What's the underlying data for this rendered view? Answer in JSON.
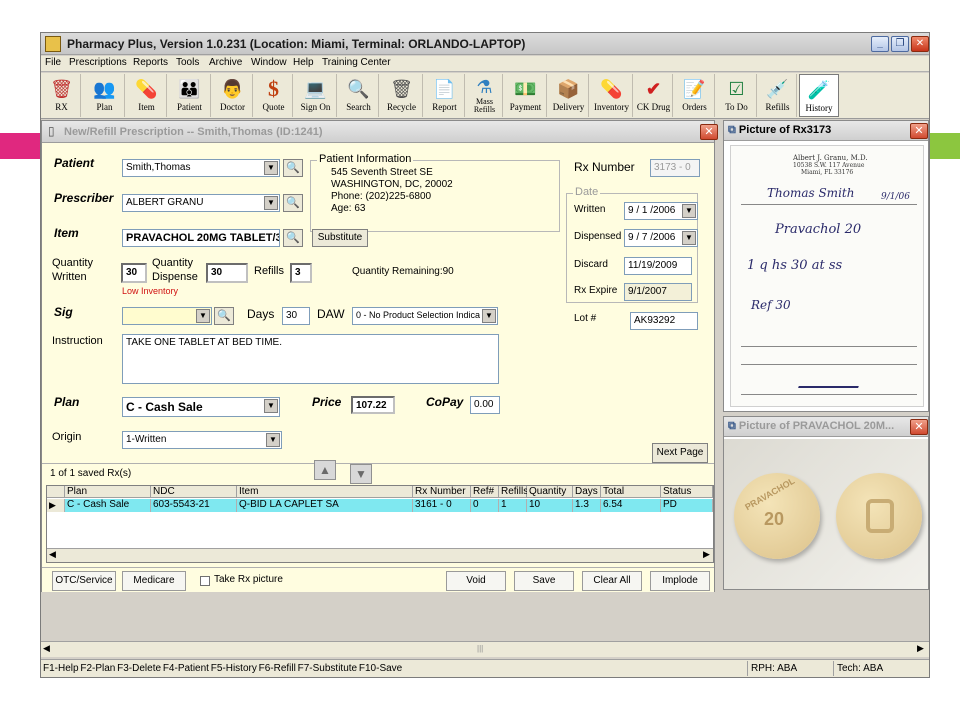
{
  "window": {
    "title": "Pharmacy Plus, Version 1.0.231 (Location: Miami, Terminal: ORLANDO-LAPTOP)",
    "minimize": "_",
    "maximize": "❐",
    "close": "✕"
  },
  "menu": [
    "File",
    "Prescriptions",
    "Reports",
    "Tools",
    "Archive",
    "Window",
    "Help",
    "Training Center"
  ],
  "toolbar": [
    {
      "label": "RX",
      "icon": "rx-icon",
      "glyph": "🗑"
    },
    {
      "label": "Plan",
      "icon": "plan-icon",
      "glyph": "👥"
    },
    {
      "label": "Item",
      "icon": "item-icon",
      "glyph": "💊"
    },
    {
      "label": "Patient",
      "icon": "patient-icon",
      "glyph": "👪"
    },
    {
      "label": "Doctor",
      "icon": "doctor-icon",
      "glyph": "👨"
    },
    {
      "label": "Quote",
      "icon": "quote-icon",
      "glyph": "$"
    },
    {
      "label": "Sign On",
      "icon": "sign-on-icon",
      "glyph": "💻"
    },
    {
      "label": "Search",
      "icon": "search-icon",
      "glyph": "🔍"
    },
    {
      "label": "Recycle",
      "icon": "recycle-icon",
      "glyph": "🗑"
    },
    {
      "label": "Report",
      "icon": "report-icon",
      "glyph": "📄"
    },
    {
      "label": "Mass Refills",
      "icon": "mass-refills-icon",
      "glyph": "⚗"
    },
    {
      "label": "Payment",
      "icon": "payment-icon",
      "glyph": "💵"
    },
    {
      "label": "Delivery",
      "icon": "delivery-icon",
      "glyph": "📦"
    },
    {
      "label": "Inventory",
      "icon": "inventory-icon",
      "glyph": "💊"
    },
    {
      "label": "CK Drug",
      "icon": "ck-drug-icon",
      "glyph": "✔"
    },
    {
      "label": "Orders",
      "icon": "orders-icon",
      "glyph": "📝"
    },
    {
      "label": "To Do",
      "icon": "to-do-icon",
      "glyph": "☑"
    },
    {
      "label": "Refills",
      "icon": "refills-icon",
      "glyph": "💉"
    },
    {
      "label": "History",
      "icon": "history-icon",
      "glyph": "🧪"
    }
  ],
  "form": {
    "title": "New/Refill Prescription -- Smith,Thomas (ID:1241)",
    "close": "✕",
    "patient_label": "Patient",
    "patient_value": "Smith,Thomas",
    "prescriber_label": "Prescriber",
    "prescriber_value": "ALBERT GRANU",
    "item_label": "Item",
    "item_value": "PRAVACHOL 20MG TABLET/3-",
    "substitute_button": "Substitute",
    "patient_info": {
      "caption": "Patient Information",
      "line1": "545 Seventh Street SE",
      "line2": "WASHINGTON, DC, 20002",
      "line3": "Phone: (202)225-6800",
      "line4": "Age: 63"
    },
    "qty_written_label1": "Quantity",
    "qty_written_label2": "Written",
    "qty_written_value": "30",
    "qty_dispense_label1": "Quantity",
    "qty_dispense_label2": "Dispense",
    "qty_dispense_value": "30",
    "refills_label": "Refills",
    "refills_value": "3",
    "qty_remaining": "Quantity Remaining:90",
    "low_inventory": "Low Inventory",
    "sig_label": "Sig",
    "sig_value": "",
    "days_label": "Days",
    "days_value": "30",
    "daw_label": "DAW",
    "daw_value": "0 - No Product Selection Indica",
    "instruction_label": "Instruction",
    "instruction_value": "TAKE ONE TABLET AT BED TIME.",
    "plan_label": "Plan",
    "plan_value": "C - Cash Sale",
    "price_label": "Price",
    "price_value": "107.22",
    "copay_label": "CoPay",
    "copay_value": "0.00",
    "origin_label": "Origin",
    "origin_value": "1-Written",
    "rx_number_label": "Rx Number",
    "rx_number_value": "3173 - 0",
    "date_caption": "Date",
    "written_label": "Written",
    "written_value": "9 / 1 /2006",
    "dispensed_label": "Dispensed",
    "dispensed_value": "9 / 7 /2006",
    "discard_label": "Discard",
    "discard_value": "11/19/2009",
    "rx_expire_label": "Rx Expire",
    "rx_expire_value": "9/1/2007",
    "lot_label": "Lot #",
    "lot_value": "AK93292",
    "next_page": "Next Page",
    "saved_count": "1 of 1 saved Rx(s)",
    "up_arrow": "▲",
    "down_arrow": "▼"
  },
  "grid": {
    "headers": [
      "Plan",
      "NDC",
      "Item",
      "Rx Number",
      "Ref#",
      "Refills",
      "Quantity",
      "Days",
      "Total",
      "Status"
    ],
    "rows": [
      [
        "C - Cash Sale",
        "603-5543-21",
        "Q-BID LA CAPLET SA",
        "3161 - 0",
        "0",
        "1",
        "10",
        "1.3",
        "6.54",
        "PD"
      ]
    ]
  },
  "footer": {
    "otc": "OTC/Service",
    "medicare": "Medicare",
    "take_picture": "Take Rx picture",
    "void": "Void",
    "save": "Save",
    "clear_all": "Clear All",
    "implode": "Implode"
  },
  "rx_picture": {
    "title": "Picture of Rx3173",
    "doctor_line1": "Albert J. Granu, M.D.",
    "doctor_line2": "10538 S.W. 117 Avenue",
    "doctor_line3": "Miami, FL 33176",
    "patient_script": "Thomas Smith",
    "date_script": "9/1/06",
    "drug_script": "Pravachol 20",
    "sig_script": "1 q hs 30 at ss",
    "refill_script": "Ref 30",
    "close": "✕"
  },
  "pill_picture": {
    "title": "Picture of PRAVACHOL 20M...",
    "imprint1": "PRAVACHOL",
    "imprint2": "20",
    "close": "✕"
  },
  "statusbar": {
    "keys": "F1-Help  F2-Plan  F3-Delete  F4-Patient  F5-History  F6-Refill  F7-Substitute  F10-Save",
    "rph": "RPH: ABA",
    "tech": "Tech: ABA"
  }
}
